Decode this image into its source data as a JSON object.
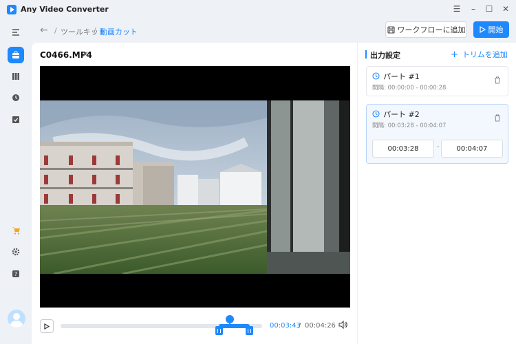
{
  "app": {
    "title": "Any Video Converter"
  },
  "window_controls": [
    "menu-icon",
    "minimize-icon",
    "maximize-icon",
    "close-icon"
  ],
  "sidebar": {
    "items": [
      {
        "icon": "collapse-sidebar-icon"
      },
      {
        "icon": "toolkit-icon",
        "active": true
      },
      {
        "icon": "library-icon"
      },
      {
        "icon": "history-icon"
      },
      {
        "icon": "task-icon"
      },
      {
        "icon": "cart-icon"
      },
      {
        "icon": "gear-icon"
      },
      {
        "icon": "help-icon"
      },
      {
        "icon": "avatar"
      }
    ]
  },
  "breadcrumb": {
    "toolkit": "ツールキット",
    "current": "動画カット",
    "sep": "/"
  },
  "toolbar": {
    "workflow_label": "ワークフローに追加",
    "start_label": "開始"
  },
  "file": {
    "name": "C0466.MP4"
  },
  "player": {
    "current_time": "00:03:43",
    "time_sep": "/",
    "total_time": "00:04:26",
    "playhead_fraction": 0.838,
    "selection_start_fraction": 0.785,
    "selection_end_fraction": 0.938
  },
  "output": {
    "title": "出力設定",
    "add_trim_label": "トリムを追加",
    "parts": [
      {
        "name": "パート #1",
        "range": "間隔: 00:00:00 - 00:00:28"
      },
      {
        "name": "パート #2",
        "range": "間隔: 00:03:28 - 00:04:07",
        "start": "00:03:28",
        "end": "00:04:07",
        "dash": "-"
      }
    ]
  },
  "colors": {
    "accent": "#1e88ff",
    "background": "#eef1f6"
  }
}
